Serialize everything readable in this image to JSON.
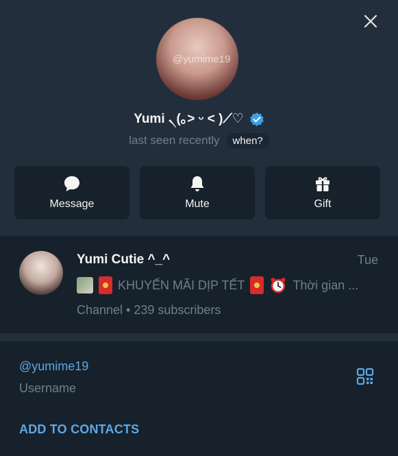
{
  "profile": {
    "avatar_watermark": "@yumime19",
    "name": "Yumi ৲(｡> ᵕ < )⟋♡",
    "status": "last seen recently",
    "when_label": "when?"
  },
  "actions": {
    "message": "Message",
    "mute": "Mute",
    "gift": "Gift"
  },
  "channel": {
    "title": "Yumi Cutie ^_^",
    "time": "Tue",
    "preview_text": "KHUYẾN MÃI DỊP TẾT",
    "preview_tail": "Thời gian ...",
    "subtitle": "Channel • 239 subscribers"
  },
  "info": {
    "username": "@yumime19",
    "username_label": "Username",
    "add_contacts": "ADD TO CONTACTS"
  },
  "colors": {
    "accent": "#5ca8e6",
    "verified": "#3a9fe6",
    "muted": "#6d7f8f",
    "header_bg": "#232e3c",
    "panel_bg": "#17212b"
  },
  "icons": {
    "close": "close-icon",
    "verified": "verified-badge-icon",
    "message": "chat-bubble-icon",
    "mute": "bell-icon",
    "gift": "gift-icon",
    "qr": "qr-code-icon"
  }
}
